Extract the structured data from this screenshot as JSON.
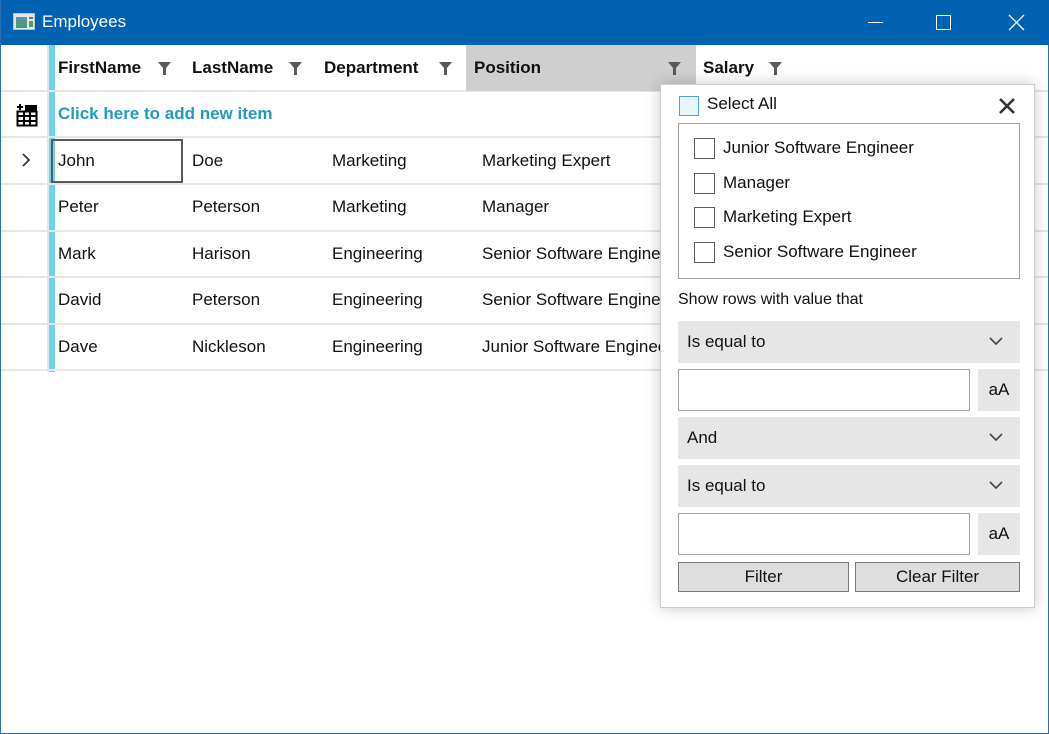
{
  "window": {
    "title": "Employees",
    "accent_color": "#0063b1"
  },
  "grid": {
    "columns": [
      {
        "key": "first",
        "label": "FirstName",
        "filter_icon": "funnel-icon"
      },
      {
        "key": "last",
        "label": "LastName",
        "filter_icon": "funnel-icon"
      },
      {
        "key": "dept",
        "label": "Department",
        "filter_icon": "funnel-icon"
      },
      {
        "key": "pos",
        "label": "Position",
        "filter_icon": "funnel-icon",
        "selected": true
      },
      {
        "key": "salary",
        "label": "Salary",
        "filter_icon": "funnel-icon"
      }
    ],
    "new_item_text": "Click here to add new item",
    "rows": [
      {
        "first": "John",
        "last": "Doe",
        "dept": "Marketing",
        "pos": "Marketing Expert",
        "current": true
      },
      {
        "first": "Peter",
        "last": "Peterson",
        "dept": "Marketing",
        "pos": "Manager"
      },
      {
        "first": "Mark",
        "last": "Harison",
        "dept": "Engineering",
        "pos": "Senior Software Engineer"
      },
      {
        "first": "David",
        "last": "Peterson",
        "dept": "Engineering",
        "pos": "Senior Software Engineer"
      },
      {
        "first": "Dave",
        "last": "Nickleson",
        "dept": "Engineering",
        "pos": "Junior Software Engineer"
      }
    ],
    "indicator_color": "#6bd3eb",
    "link_color": "#1f9bc1"
  },
  "filter_popup": {
    "select_all_label": "Select All",
    "select_all_checked": false,
    "distinct_values": [
      {
        "label": "Junior Software Engineer",
        "checked": false
      },
      {
        "label": "Manager",
        "checked": false
      },
      {
        "label": "Marketing Expert",
        "checked": false
      },
      {
        "label": "Senior Software Engineer",
        "checked": false
      }
    ],
    "show_rows_label": "Show rows with value that",
    "operator1": "Is equal to",
    "value1": "",
    "case_label1": "aA",
    "logical_operator": "And",
    "operator2": "Is equal to",
    "value2": "",
    "case_label2": "aA",
    "filter_button": "Filter",
    "clear_button": "Clear Filter"
  }
}
